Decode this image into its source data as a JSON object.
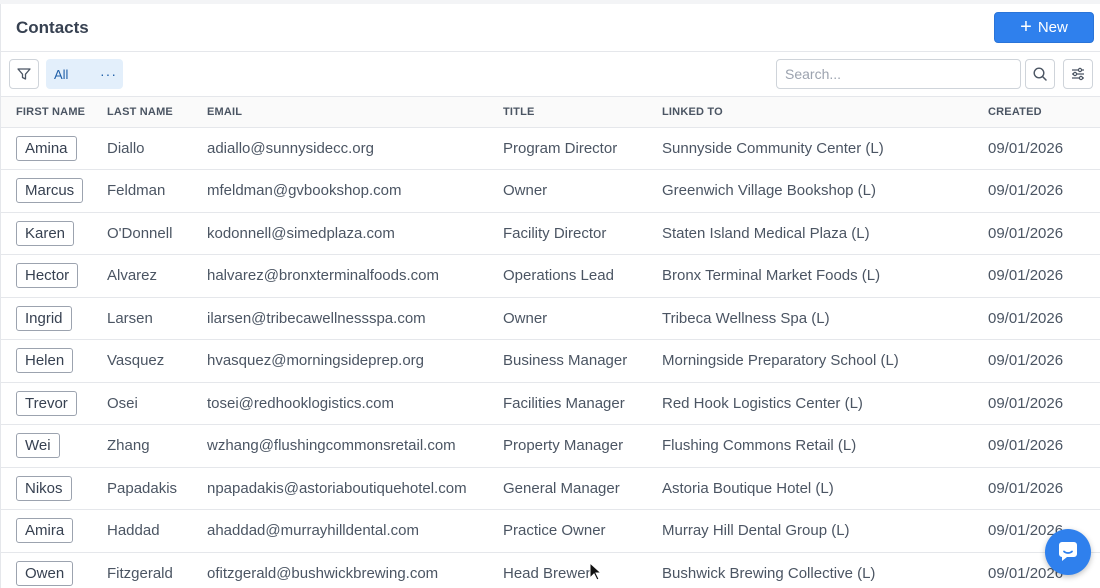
{
  "header": {
    "title": "Contacts",
    "new_label": "New"
  },
  "toolbar": {
    "view_label": "All",
    "view_more": "···",
    "search_placeholder": "Search..."
  },
  "table": {
    "columns": [
      "FIRST NAME",
      "LAST NAME",
      "EMAIL",
      "TITLE",
      "LINKED TO",
      "CREATED"
    ],
    "rows": [
      {
        "first": "Amina",
        "last": "Diallo",
        "email": "adiallo@sunnysidecc.org",
        "title": "Program Director",
        "linked": "Sunnyside Community Center (L)",
        "created": "09/01/2026"
      },
      {
        "first": "Marcus",
        "last": "Feldman",
        "email": "mfeldman@gvbookshop.com",
        "title": "Owner",
        "linked": "Greenwich Village Bookshop (L)",
        "created": "09/01/2026"
      },
      {
        "first": "Karen",
        "last": "O'Donnell",
        "email": "kodonnell@simedplaza.com",
        "title": "Facility Director",
        "linked": "Staten Island Medical Plaza (L)",
        "created": "09/01/2026"
      },
      {
        "first": "Hector",
        "last": "Alvarez",
        "email": "halvarez@bronxterminalfoods.com",
        "title": "Operations Lead",
        "linked": "Bronx Terminal Market Foods (L)",
        "created": "09/01/2026"
      },
      {
        "first": "Ingrid",
        "last": "Larsen",
        "email": "ilarsen@tribecawellnessspa.com",
        "title": "Owner",
        "linked": "Tribeca Wellness Spa (L)",
        "created": "09/01/2026"
      },
      {
        "first": "Helen",
        "last": "Vasquez",
        "email": "hvasquez@morningsideprep.org",
        "title": "Business Manager",
        "linked": "Morningside Preparatory School (L)",
        "created": "09/01/2026"
      },
      {
        "first": "Trevor",
        "last": "Osei",
        "email": "tosei@redhooklogistics.com",
        "title": "Facilities Manager",
        "linked": "Red Hook Logistics Center (L)",
        "created": "09/01/2026"
      },
      {
        "first": "Wei",
        "last": "Zhang",
        "email": "wzhang@flushingcommonsretail.com",
        "title": "Property Manager",
        "linked": "Flushing Commons Retail (L)",
        "created": "09/01/2026"
      },
      {
        "first": "Nikos",
        "last": "Papadakis",
        "email": "npapadakis@astoriaboutiquehotel.com",
        "title": "General Manager",
        "linked": "Astoria Boutique Hotel (L)",
        "created": "09/01/2026"
      },
      {
        "first": "Amira",
        "last": "Haddad",
        "email": "ahaddad@murrayhilldental.com",
        "title": "Practice Owner",
        "linked": "Murray Hill Dental Group (L)",
        "created": "09/01/2026"
      },
      {
        "first": "Owen",
        "last": "Fitzgerald",
        "email": "ofitzgerald@bushwickbrewing.com",
        "title": "Head Brewer",
        "linked": "Bushwick Brewing Collective (L)",
        "created": "09/01/2026"
      }
    ]
  },
  "colors": {
    "accent": "#2f80ed",
    "tab_bg": "#e3effb",
    "border": "#e5e7eb"
  },
  "icons": [
    "filter-icon",
    "search-icon",
    "sliders-icon",
    "plus-icon",
    "chat-icon"
  ]
}
